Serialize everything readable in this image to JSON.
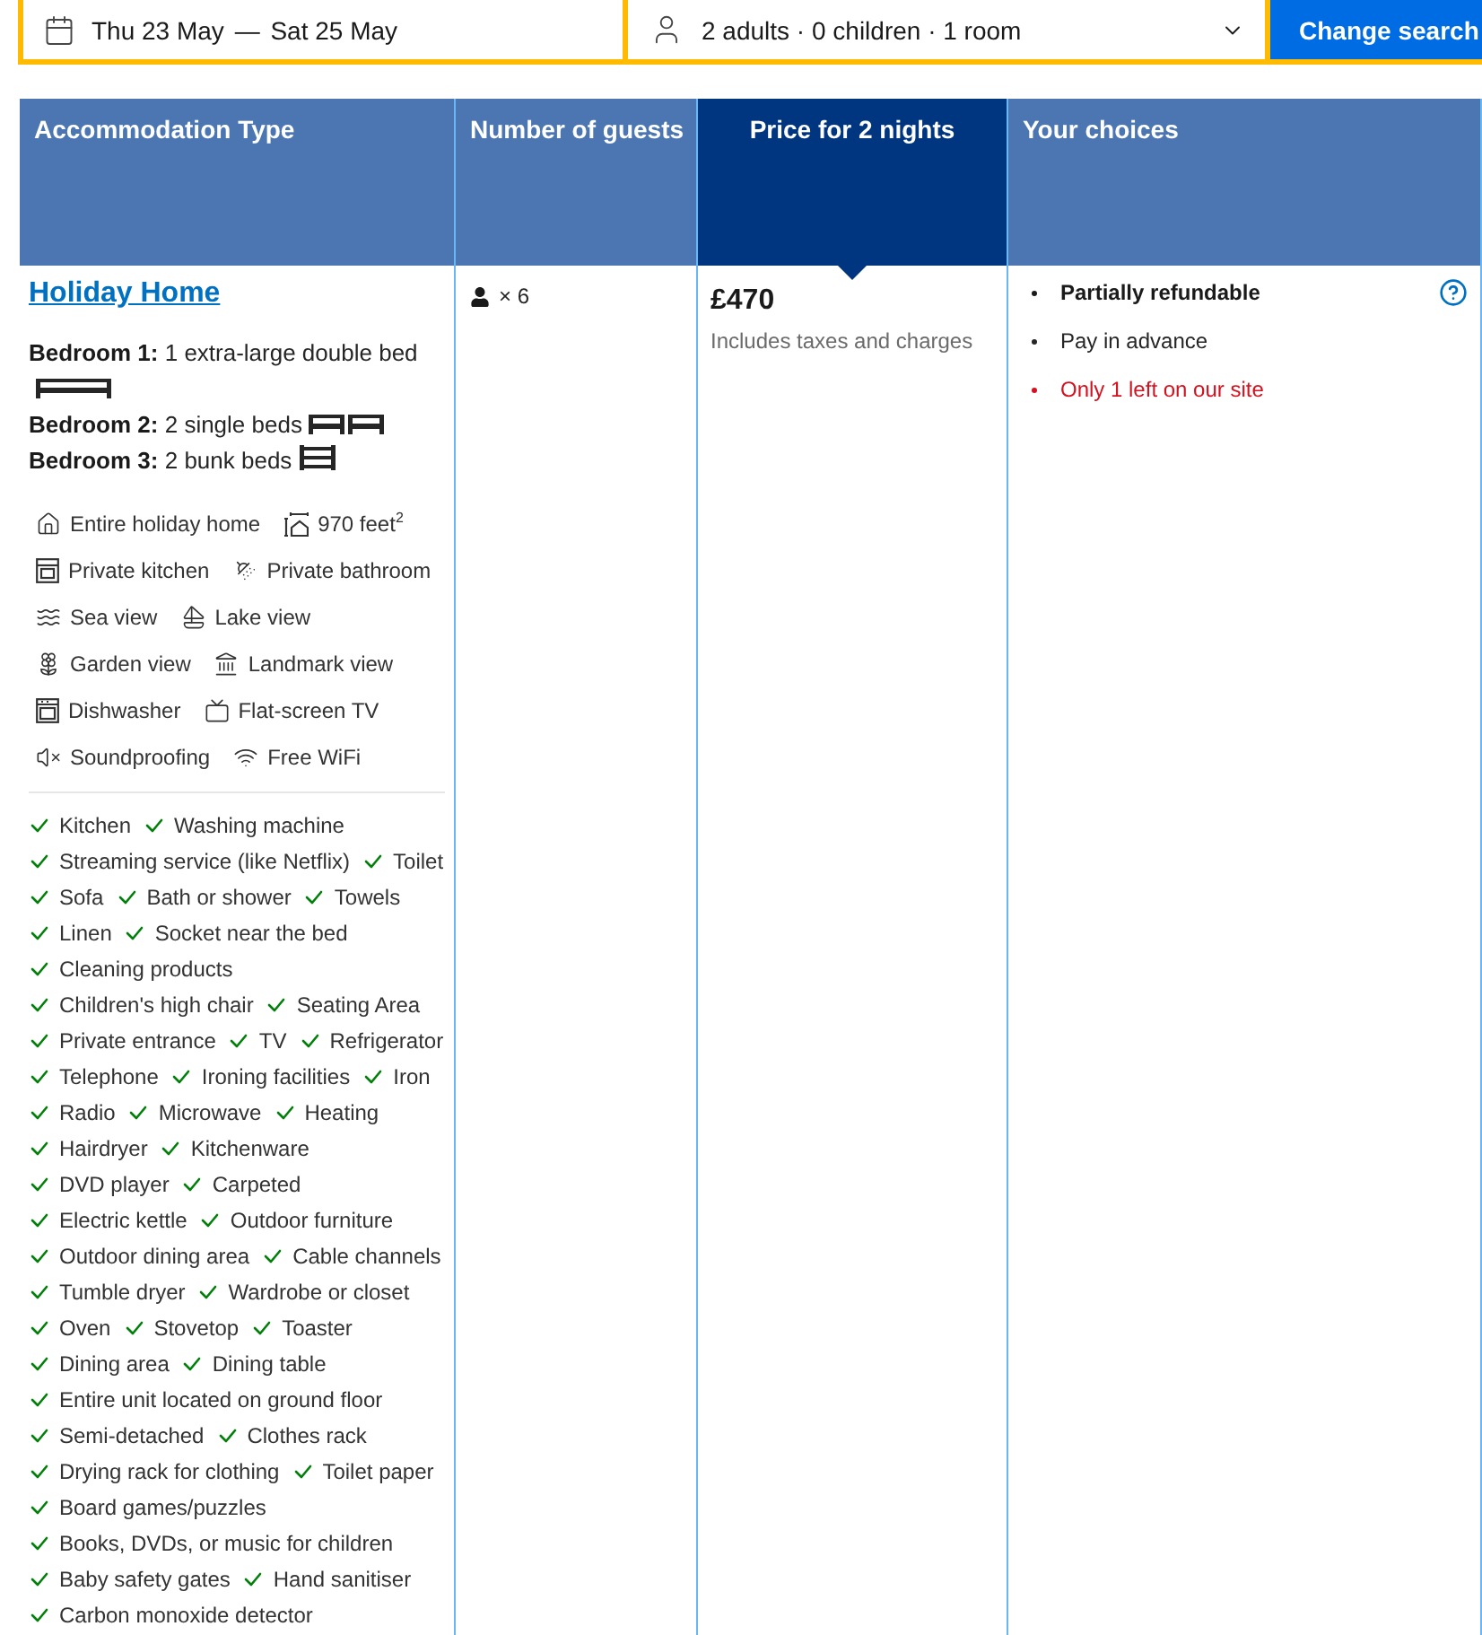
{
  "search_bar": {
    "check_in": "Thu 23 May",
    "separator": "—",
    "check_out": "Sat 25 May",
    "guests": "2 adults · 0 children · 1 room",
    "button": "Change search"
  },
  "table": {
    "columns": [
      {
        "label": "Accommodation Type",
        "selected": false
      },
      {
        "label": "Number of guests",
        "selected": false
      },
      {
        "label": "Price for 2 nights",
        "selected": true
      },
      {
        "label": "Your choices",
        "selected": false
      }
    ],
    "row": {
      "accommodation": {
        "name": "Holiday Home",
        "bedrooms": [
          {
            "text": "**Bedroom 1:** 1 extra-large double bed",
            "beds": [
              {
                "kind": "double"
              }
            ]
          },
          {
            "text": "**Bedroom 2:** 2 single beds",
            "beds": [
              {
                "kind": "single"
              },
              {
                "kind": "single"
              }
            ]
          },
          {
            "text": "**Bedroom 3:** 2 bunk beds",
            "beds": [
              {
                "kind": "bunk"
              }
            ]
          }
        ],
        "facility_rows": [
          [
            {
              "kind": "property",
              "label": "Entire holiday home"
            },
            {
              "kind": "area",
              "label": "970 feet$^{2}$"
            }
          ],
          [
            {
              "kind": "kitchen",
              "label": "Private kitchen"
            },
            {
              "kind": "bathroom",
              "label": "Private bathroom"
            }
          ],
          [
            {
              "kind": "seaview",
              "label": "Sea view"
            },
            {
              "kind": "lakeview",
              "label": "Lake view"
            }
          ],
          [
            {
              "kind": "gardenview",
              "label": "Garden view"
            },
            {
              "kind": "landmarkview",
              "label": "Landmark view"
            }
          ],
          [
            {
              "kind": "dishwasher",
              "label": "Dishwasher"
            },
            {
              "kind": "tv",
              "label": "Flat-screen TV"
            }
          ],
          [
            {
              "kind": "soundproofing",
              "label": "Soundproofing"
            },
            {
              "kind": "wifi",
              "label": "Free WiFi"
            }
          ]
        ],
        "amenity_rows": [
          [
            "Kitchen",
            "Washing machine"
          ],
          [
            "Streaming service (like Netflix)",
            "Toilet"
          ],
          [
            "Sofa",
            "Bath or shower",
            "Towels"
          ],
          [
            "Linen",
            "Socket near the bed"
          ],
          [
            "Cleaning products"
          ],
          [
            "Children's high chair",
            "Seating Area"
          ],
          [
            "Private entrance",
            "TV",
            "Refrigerator"
          ],
          [
            "Telephone",
            "Ironing facilities",
            "Iron"
          ],
          [
            "Radio",
            "Microwave",
            "Heating"
          ],
          [
            "Hairdryer",
            "Kitchenware"
          ],
          [
            "DVD player",
            "Carpeted"
          ],
          [
            "Electric kettle",
            "Outdoor furniture"
          ],
          [
            "Outdoor dining area",
            "Cable channels"
          ],
          [
            "Tumble dryer",
            "Wardrobe or closet"
          ],
          [
            "Oven",
            "Stovetop",
            "Toaster"
          ],
          [
            "Dining area",
            "Dining table"
          ],
          [
            "Entire unit located on ground floor"
          ],
          [
            "Semi-detached",
            "Clothes rack"
          ],
          [
            "Drying rack for clothing",
            "Toilet paper"
          ],
          [
            "Board games/puzzles"
          ],
          [
            "Books, DVDs, or music for children"
          ],
          [
            "Baby safety gates",
            "Hand sanitiser"
          ],
          [
            "Carbon monoxide detector"
          ]
        ]
      },
      "guests": {
        "count": "× 6"
      },
      "price": {
        "amount": "£470",
        "note": "Includes taxes and charges"
      },
      "choices": [
        {
          "kind": "strong",
          "text": "Partially refundable"
        },
        {
          "kind": "plain",
          "text": "Pay in advance"
        },
        {
          "kind": "warning",
          "text": "Only 1 left on our site"
        }
      ]
    }
  }
}
